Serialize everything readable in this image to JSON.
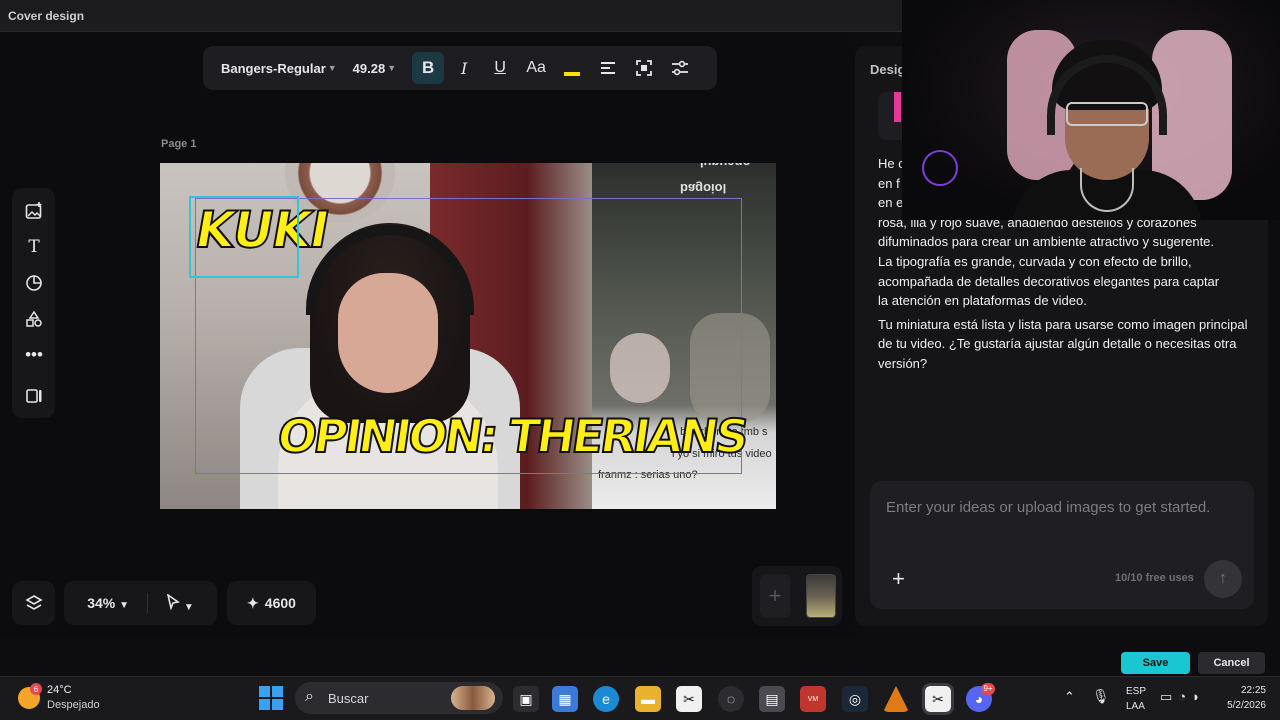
{
  "window": {
    "title": "Cover design"
  },
  "format_toolbar": {
    "font_family": "Bangers-Regular",
    "font_size": "49.28",
    "bold": "B",
    "italic": "I",
    "underline": "U",
    "text_case": "Aa",
    "text_color": "#f2e600"
  },
  "canvas": {
    "page_label": "Page 1",
    "texts": {
      "kuki": "KUKI",
      "opinion": "OPINION: THERIANS"
    },
    "chat_lines": [
      ": bicarbonato tmb s",
      "l yo si miro tus video",
      "franmz : serias uno?"
    ],
    "mirrored_overlay": [
      "lupuaqo",
      "bagoiol"
    ]
  },
  "bottom_controls": {
    "zoom": "34%",
    "credits": "4600"
  },
  "right_panel": {
    "header": "Desig",
    "response_lines": [
      "He c",
      "en f",
      "en e",
      "rosa, lila y rojo suave, añadiendo destellos y corazones",
      "difuminados para crear un ambiente atractivo y sugerente.",
      "La tipografía es grande, curvada y con efecto de brillo,",
      "acompañada de detalles decorativos elegantes para captar",
      "la atención en plataformas de video."
    ],
    "followup": "Tu miniatura está lista y lista para usarse como imagen principal de tu video. ¿Te gustaría ajustar algún detalle o necesitas otra versión?",
    "prompt_placeholder": "Enter your ideas or upload images to get started.",
    "free_uses": "10/10 free uses"
  },
  "actions": {
    "save": "Save",
    "cancel": "Cancel"
  },
  "taskbar": {
    "weather_badge": "6",
    "temperature": "24°C",
    "condition": "Despejado",
    "search_label": "Buscar",
    "discord_badge": "9+",
    "lang_line1": "ESP",
    "lang_line2": "LAA",
    "time": "22:25",
    "date": "5/2/2026"
  },
  "colors": {
    "accent": "#19c7d3",
    "selection": "#2fc7d6",
    "title_text": "#ffef16"
  }
}
